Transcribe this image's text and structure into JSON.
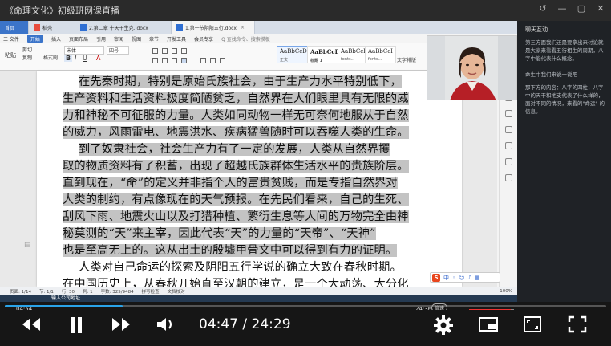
{
  "window": {
    "title": "《命理文化》初级班网课直播",
    "controls": [
      "↺",
      "—",
      "▢",
      "✕"
    ]
  },
  "wps": {
    "tabs": [
      {
        "label": "首页",
        "kind": "home"
      },
      {
        "label": "稻壳",
        "kind": "normal"
      },
      {
        "label": "2.第二章 十天干生克..docx",
        "kind": "normal"
      },
      {
        "label": "1.第一节阴阳五行.docx",
        "kind": "active"
      }
    ],
    "menu": {
      "file": "三 文件",
      "start": "开始",
      "items": [
        "插入",
        "页面布局",
        "引用",
        "审阅",
        "视图",
        "章节",
        "开发工具",
        "会员专享"
      ],
      "search": "Q 查找命令、搜索模板"
    },
    "tools": {
      "paste": "粘贴",
      "cut": "剪切",
      "copy": "复制",
      "format_painter": "格式刷",
      "font_name": "宋体",
      "font_size": "四号",
      "styles": [
        {
          "sample": "AaBbCcDd",
          "caption": "正文"
        },
        {
          "sample": "AaBbCcDd",
          "caption": "标题 1"
        },
        {
          "sample": "AaBbCcD",
          "caption": "fonts..."
        },
        {
          "sample": "AaBbCcI",
          "caption": "fonts..."
        }
      ],
      "text_editing": "文字排版"
    },
    "document_lines": [
      {
        "indent": true,
        "text": "在先秦时期，特别是原始氏族社会，由于生产力水平特别低下，",
        "highlight": true
      },
      {
        "indent": false,
        "text": "生产资料和生活资料极度简陋贫乏，自然界在人们眼里具有无限的威",
        "highlight": true
      },
      {
        "indent": false,
        "text": "力和神秘不可征服的力量。人类如同动物一样无可奈何地服从于自然",
        "highlight": true
      },
      {
        "indent": false,
        "text": "的威力，风雨雷电、地震洪水、疾病猛兽随时可以吞噬人类的生命。",
        "highlight": true
      },
      {
        "indent": true,
        "text": "到了奴隶社会，社会生产力有了一定的发展，人类从自然界攫",
        "highlight": true
      },
      {
        "indent": false,
        "text": "取的物质资料有了积蓄，出现了超越氏族群体生活水平的贵族阶层。",
        "highlight": true
      },
      {
        "indent": false,
        "text": "直到现在，“命”的定义并非指个人的富贵贫贱，而是专指自然界对",
        "highlight": true
      },
      {
        "indent": false,
        "text": "人类的制约，有点像现在的天气预报。在先民们看来，自己的生死、",
        "highlight": true
      },
      {
        "indent": false,
        "text": "刮风下雨、地震火山以及打猎种植、繁衍生息等人间的万物完全由神",
        "highlight": true
      },
      {
        "indent": false,
        "text": "秘莫测的“天”来主宰，因此代表“天”的力量的“天帝”、“天神”",
        "highlight": true
      },
      {
        "indent": false,
        "text": "也是至高无上的。这从出土的殷墟甲骨文中可以得到有力的证明。",
        "highlight": true
      },
      {
        "indent": true,
        "text": "人类对自己命运的探索及阴阳五行学说的确立大致在春秋时期。",
        "highlight": false
      },
      {
        "indent": false,
        "text": "在中国历史上，从春秋开始直至汉朝的建立，是一个大动荡、大分化",
        "highlight": false
      }
    ],
    "status": {
      "page": "页面: 1/14",
      "section": "节: 1/1",
      "line": "行: 30",
      "col": "列: 1",
      "words": "字数: 325/9484",
      "spell": "拼写检查",
      "doc_check": "文档校对",
      "zoom": "100%"
    },
    "ime": {
      "logo": "S",
      "mode": "中"
    },
    "taskbar_item": "输入",
    "taskbar_label": "输入公司地址"
  },
  "chat": {
    "title": "聊天互动",
    "messages": [
      "第三方面我们还是要拿出来讨论就是大家来看看五行相生的周期，八字中能代表什么概念。",
      "命生中我们来说一说吧",
      "那下方的内容：八字的四柱，八字中的天干和地支代表了什么样的，面对不同的情况，来看的\"命运\" 的信息。"
    ]
  },
  "player": {
    "current_time": "04:47",
    "total_time": "24:29",
    "left_small_time": "04:54",
    "right_small_time": "24:36",
    "speed": "倍速",
    "progress": 0.196,
    "volume": 0.92
  }
}
